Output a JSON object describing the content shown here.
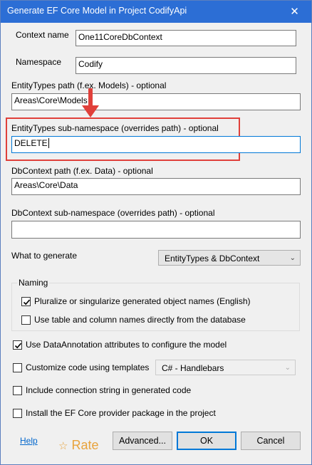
{
  "window": {
    "title": "Generate EF Core Model in Project CodifyApi",
    "close_glyph": "✕"
  },
  "fields": {
    "context_name": {
      "label": "Context name",
      "value": "One11CoreDbContext"
    },
    "namespace": {
      "label": "Namespace",
      "value": "Codify"
    },
    "entitytypes_path": {
      "label": "EntityTypes path (f.ex. Models) - optional",
      "value": "Areas\\Core\\Models"
    },
    "entitytypes_subnamespace": {
      "label": "EntityTypes sub-namespace (overrides path) - optional",
      "value": "DELETE"
    },
    "dbcontext_path": {
      "label": "DbContext path (f.ex. Data) - optional",
      "value": "Areas\\Core\\Data"
    },
    "dbcontext_subnamespace": {
      "label": "DbContext sub-namespace (overrides path) - optional",
      "value": ""
    }
  },
  "what_to_generate": {
    "label": "What to generate",
    "selected": "EntityTypes & DbContext"
  },
  "naming": {
    "title": "Naming",
    "pluralize": {
      "label": "Pluralize or singularize generated object names (English)",
      "checked": true
    },
    "use_db_names": {
      "label": "Use table and column names directly from the database",
      "checked": false
    }
  },
  "options": {
    "data_annotations": {
      "label": "Use DataAnnotation attributes to configure the model",
      "checked": true
    },
    "templates": {
      "label": "Customize code using templates",
      "checked": false,
      "template_selected": "C# - Handlebars"
    },
    "connection_string": {
      "label": "Include connection string in generated code",
      "checked": false
    },
    "install_provider": {
      "label": "Install the EF Core provider package in the project",
      "checked": false
    }
  },
  "footer": {
    "help": "Help",
    "rate": "Rate",
    "rate_icon": "star-icon",
    "advanced": "Advanced...",
    "ok": "OK",
    "cancel": "Cancel"
  },
  "annotation": {
    "highlight_color": "#e0403a"
  }
}
